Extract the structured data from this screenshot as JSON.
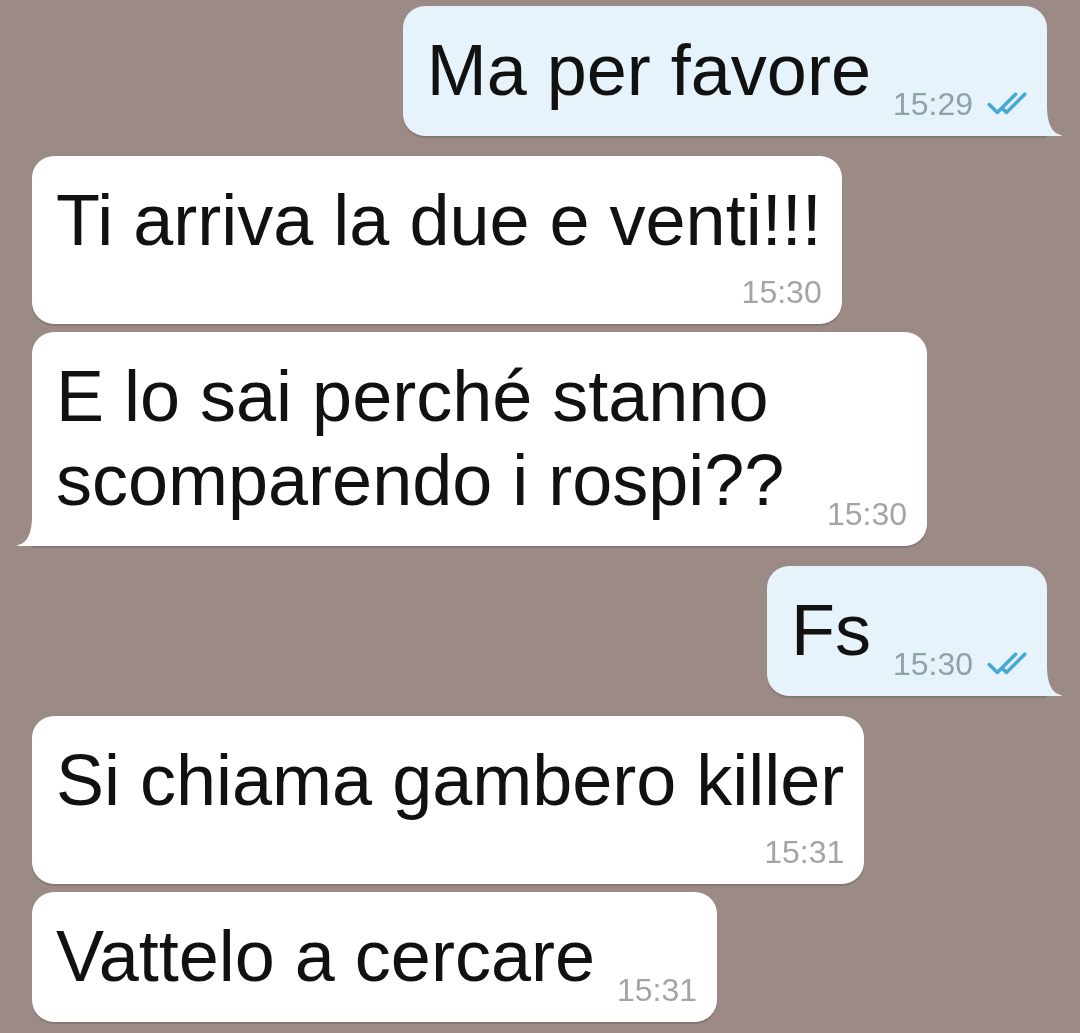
{
  "messages": [
    {
      "outgoing": true,
      "text": "Ma per favore",
      "time": "15:29",
      "read": true,
      "tail": true
    },
    {
      "outgoing": false,
      "text": "Ti arriva la due e venti!!!",
      "time": "15:30",
      "tail": false
    },
    {
      "outgoing": false,
      "text": "E lo sai perché stanno scomparendo i rospi??",
      "time": "15:30",
      "tail": true
    },
    {
      "outgoing": true,
      "text": "Fs",
      "time": "15:30",
      "read": true,
      "tail": true
    },
    {
      "outgoing": false,
      "text": "Si chiama gambero killer",
      "time": "15:31",
      "tail": false
    },
    {
      "outgoing": false,
      "text": "Vattelo a cercare",
      "time": "15:31",
      "tail": false
    }
  ]
}
